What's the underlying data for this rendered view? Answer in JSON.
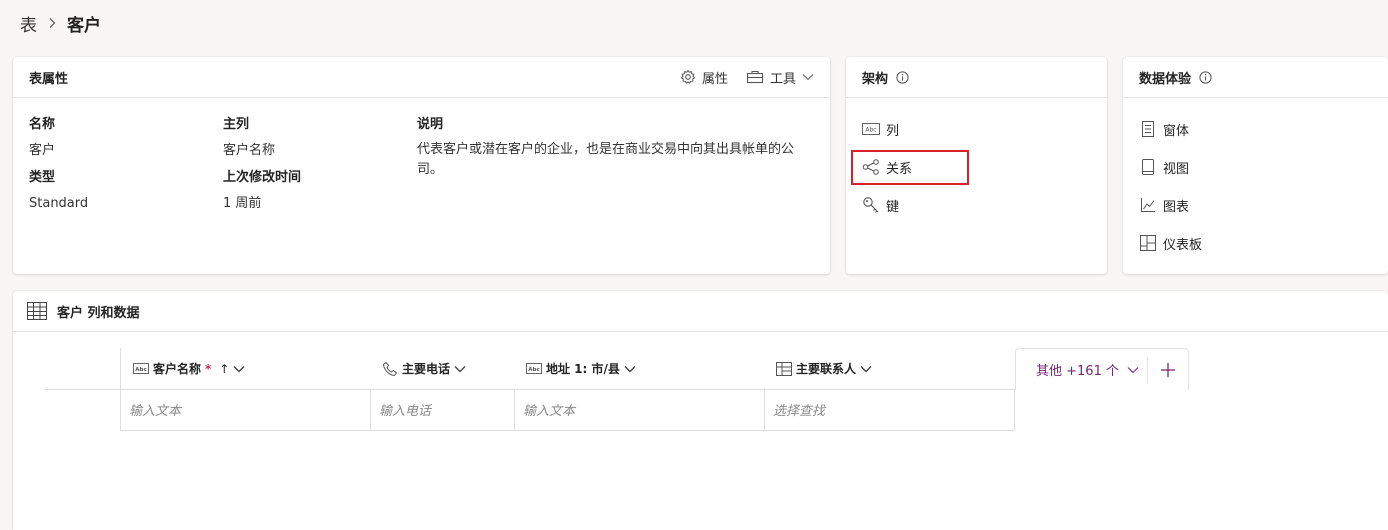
{
  "breadcrumb": {
    "root": "表",
    "current": "客户"
  },
  "props_card": {
    "title": "表属性",
    "properties_btn": "属性",
    "tools_btn": "工具",
    "name_label": "名称",
    "name_value": "客户",
    "type_label": "类型",
    "type_value": "Standard",
    "primary_col_label": "主列",
    "primary_col_value": "客户名称",
    "modified_label": "上次修改时间",
    "modified_value": "1 周前",
    "desc_label": "说明",
    "desc_value": "代表客户或潜在客户的企业，也是在商业交易中向其出具帐单的公司。"
  },
  "schema_card": {
    "title": "架构",
    "items": [
      {
        "label": "列",
        "icon": "abc-text-icon"
      },
      {
        "label": "关系",
        "icon": "relationship-icon"
      },
      {
        "label": "键",
        "icon": "key-icon"
      }
    ]
  },
  "experience_card": {
    "title": "数据体验",
    "items": [
      {
        "label": "窗体",
        "icon": "form-icon"
      },
      {
        "label": "视图",
        "icon": "view-icon"
      },
      {
        "label": "图表",
        "icon": "chart-icon"
      },
      {
        "label": "仪表板",
        "icon": "dashboard-icon"
      }
    ]
  },
  "data_section": {
    "title": "客户 列和数据",
    "columns": [
      {
        "label": "客户名称",
        "required": "*",
        "sort": "↑",
        "placeholder": "输入文本"
      },
      {
        "label": "主要电话",
        "placeholder": "输入电话"
      },
      {
        "label": "地址 1: 市/县",
        "placeholder": "输入文本"
      },
      {
        "label": "主要联系人",
        "placeholder": "选择查找"
      }
    ],
    "more_columns": "其他 +161 个"
  },
  "colors": {
    "accent": "#742774",
    "highlight": "#d9202b"
  }
}
